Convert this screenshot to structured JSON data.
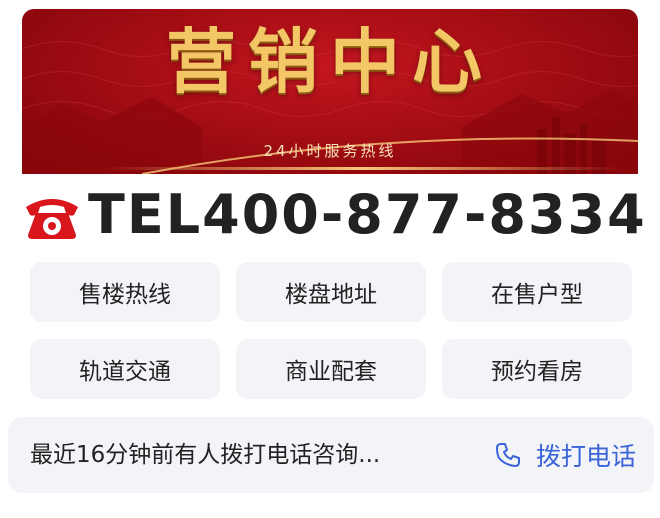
{
  "banner": {
    "title": "营销中心",
    "subtitle": "24小时服务热线"
  },
  "tel": {
    "text": "TEL400-877-8334",
    "icon": "telephone-icon"
  },
  "buttons": [
    {
      "label": "售楼热线"
    },
    {
      "label": "楼盘地址"
    },
    {
      "label": "在售户型"
    },
    {
      "label": "轨道交通"
    },
    {
      "label": "商业配套"
    },
    {
      "label": "预约看房"
    }
  ],
  "bottom_bar": {
    "notice": "最近16分钟前有人拨打电话咨询...",
    "call_label": "拨打电话",
    "call_icon": "phone-icon"
  },
  "colors": {
    "banner_red": "#a50d14",
    "banner_gold": "#f3c766",
    "accent_blue": "#3b64d8",
    "button_bg": "#f2f4f8"
  }
}
